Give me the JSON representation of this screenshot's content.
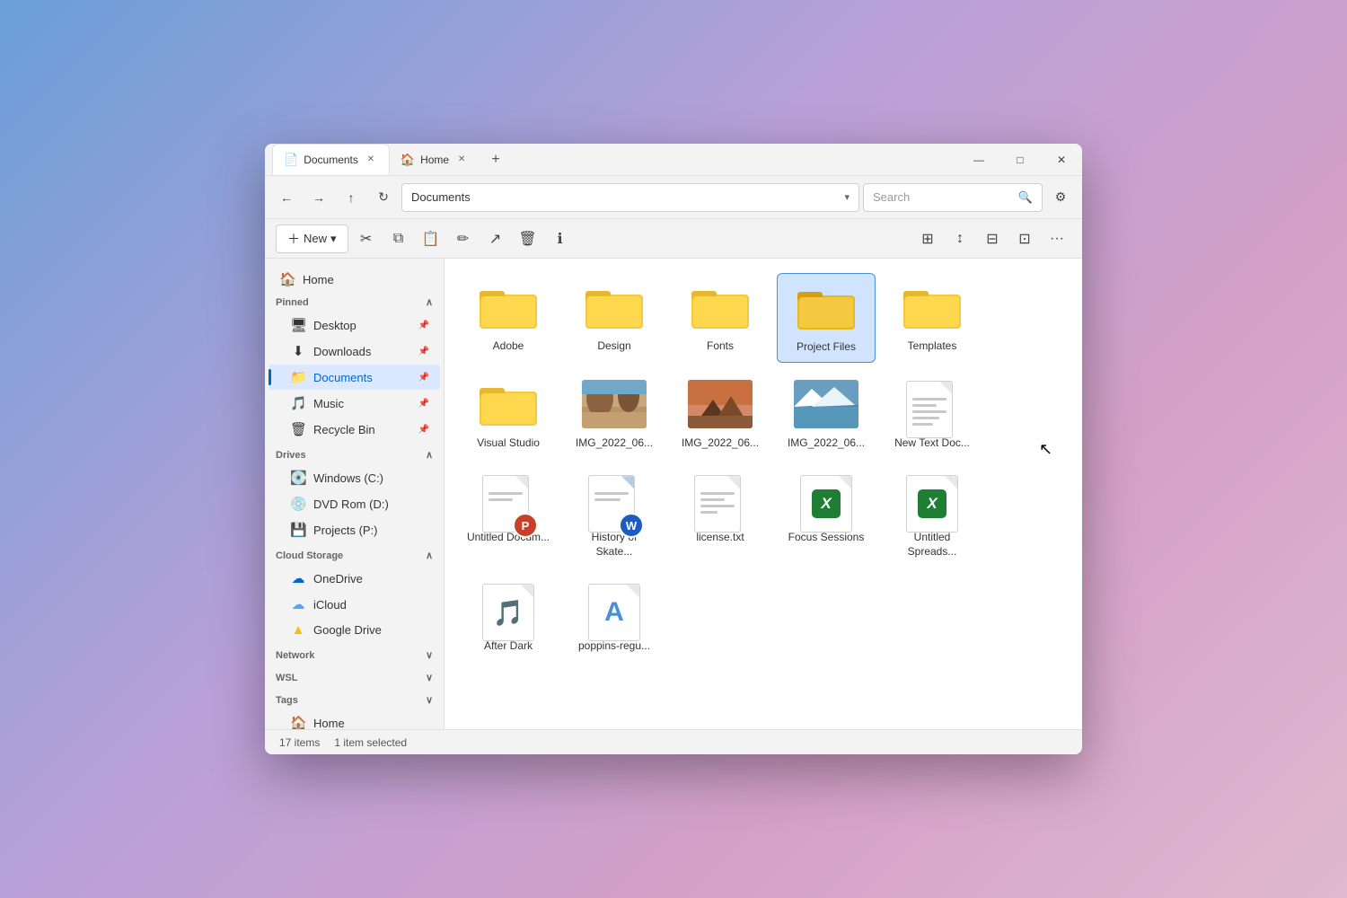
{
  "window": {
    "title": "Documents",
    "tabs": [
      {
        "label": "Documents",
        "icon": "📄",
        "active": true
      },
      {
        "label": "Home",
        "icon": "🏠",
        "active": false
      }
    ],
    "controls": {
      "minimize": "—",
      "maximize": "□",
      "close": "✕"
    }
  },
  "navigation": {
    "back": "←",
    "forward": "→",
    "up": "↑",
    "refresh": "↻",
    "address": "Documents",
    "search_placeholder": "Search"
  },
  "toolbar": {
    "new_label": "New",
    "new_chevron": "▾",
    "buttons": [
      "cut",
      "copy",
      "paste",
      "rename",
      "share",
      "delete",
      "info"
    ],
    "view_buttons": [
      "view1",
      "sort",
      "view2",
      "layout",
      "more"
    ]
  },
  "sidebar": {
    "home_label": "Home",
    "pinned_label": "Pinned",
    "drives_label": "Drives",
    "cloud_storage_label": "Cloud Storage",
    "network_label": "Network",
    "tags_label": "Tags",
    "wsl_label": "WSL",
    "pinned_items": [
      {
        "label": "Desktop",
        "icon": "🖥",
        "pin": true
      },
      {
        "label": "Downloads",
        "icon": "⬇",
        "pin": true
      },
      {
        "label": "Documents",
        "icon": "📁",
        "pin": true,
        "active": true
      },
      {
        "label": "Music",
        "icon": "🎵",
        "pin": true
      },
      {
        "label": "Recycle Bin",
        "icon": "🗑",
        "pin": true
      }
    ],
    "drives": [
      {
        "label": "Windows (C:)",
        "icon": "💽"
      },
      {
        "label": "DVD Rom (D:)",
        "icon": "💿"
      },
      {
        "label": "Projects (P:)",
        "icon": "💾"
      }
    ],
    "cloud": [
      {
        "label": "OneDrive",
        "icon": "☁",
        "color": "#0066cc"
      },
      {
        "label": "iCloud",
        "icon": "☁",
        "color": "#4da6ff"
      },
      {
        "label": "Google Drive",
        "icon": "△",
        "color": "#fbbc05"
      }
    ],
    "tags_footer": [
      {
        "label": "Home",
        "icon": "🏠",
        "color": "#4a90d9"
      }
    ]
  },
  "files": {
    "folders": [
      {
        "name": "Adobe",
        "selected": false
      },
      {
        "name": "Design",
        "selected": false
      },
      {
        "name": "Fonts",
        "selected": false
      },
      {
        "name": "Project Files",
        "selected": true
      },
      {
        "name": "Templates",
        "selected": false
      },
      {
        "name": "Visual Studio",
        "selected": false
      }
    ],
    "files": [
      {
        "name": "IMG_2022_06...",
        "type": "image",
        "img": "desert"
      },
      {
        "name": "IMG_2022_06...",
        "type": "image",
        "img": "mountain"
      },
      {
        "name": "IMG_2022_06...",
        "type": "image",
        "img": "glacier"
      },
      {
        "name": "New Text Doc...",
        "type": "txt"
      },
      {
        "name": "Untitled Docum...",
        "type": "pptx"
      },
      {
        "name": "History of Skate...",
        "type": "docx"
      },
      {
        "name": "license.txt",
        "type": "txt2"
      },
      {
        "name": "Focus Sessions",
        "type": "xlsx"
      },
      {
        "name": "Untitled Spreads...",
        "type": "xlsx2"
      },
      {
        "name": "After Dark",
        "type": "music"
      },
      {
        "name": "poppins-regu...",
        "type": "font"
      }
    ]
  },
  "status_bar": {
    "items_count": "17 items",
    "selected": "1 item selected"
  }
}
